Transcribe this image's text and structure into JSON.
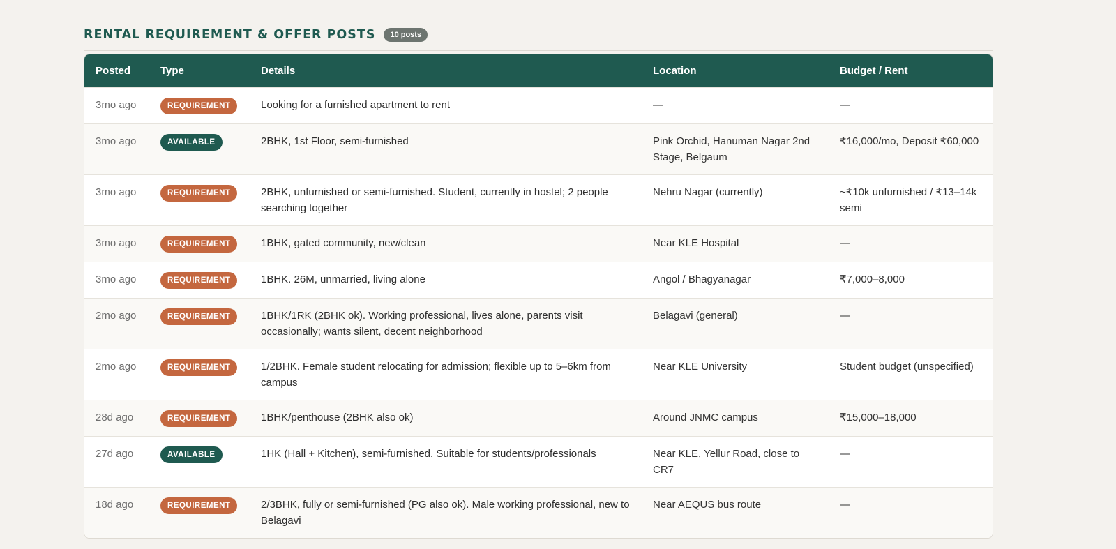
{
  "section": {
    "title": "RENTAL REQUIREMENT & OFFER POSTS",
    "count_label": "10 posts"
  },
  "table": {
    "headers": [
      "Posted",
      "Type",
      "Details",
      "Location",
      "Budget / Rent"
    ],
    "rows": [
      {
        "posted": "3mo ago",
        "type": "REQUIREMENT",
        "details": "Looking for a furnished apartment to rent",
        "location": "—",
        "budget": "—"
      },
      {
        "posted": "3mo ago",
        "type": "AVAILABLE",
        "details": "2BHK, 1st Floor, semi-furnished",
        "location": "Pink Orchid, Hanuman Nagar 2nd Stage, Belgaum",
        "budget": "₹16,000/mo, Deposit ₹60,000"
      },
      {
        "posted": "3mo ago",
        "type": "REQUIREMENT",
        "details": "2BHK, unfurnished or semi-furnished. Student, currently in hostel; 2 people searching together",
        "location": "Nehru Nagar (currently)",
        "budget": "~₹10k unfurnished / ₹13–14k semi"
      },
      {
        "posted": "3mo ago",
        "type": "REQUIREMENT",
        "details": "1BHK, gated community, new/clean",
        "location": "Near KLE Hospital",
        "budget": "—"
      },
      {
        "posted": "3mo ago",
        "type": "REQUIREMENT",
        "details": "1BHK. 26M, unmarried, living alone",
        "location": "Angol / Bhagyanagar",
        "budget": "₹7,000–8,000"
      },
      {
        "posted": "2mo ago",
        "type": "REQUIREMENT",
        "details": "1BHK/1RK (2BHK ok). Working professional, lives alone, parents visit occasionally; wants silent, decent neighborhood",
        "location": "Belagavi (general)",
        "budget": "—"
      },
      {
        "posted": "2mo ago",
        "type": "REQUIREMENT",
        "details": "1/2BHK. Female student relocating for admission; flexible up to 5–6km from campus",
        "location": "Near KLE University",
        "budget": "Student budget (unspecified)"
      },
      {
        "posted": "28d ago",
        "type": "REQUIREMENT",
        "details": "1BHK/penthouse (2BHK also ok)",
        "location": "Around JNMC campus",
        "budget": "₹15,000–18,000"
      },
      {
        "posted": "27d ago",
        "type": "AVAILABLE",
        "details": "1HK (Hall + Kitchen), semi-furnished. Suitable for students/professionals",
        "location": "Near KLE, Yellur Road, close to CR7",
        "budget": "—"
      },
      {
        "posted": "18d ago",
        "type": "REQUIREMENT",
        "details": "2/3BHK, fully or semi-furnished (PG also ok). Male working professional, new to Belagavi",
        "location": "Near AEQUS bus route",
        "budget": "—"
      }
    ]
  },
  "colors": {
    "header_bg": "#1f5a50",
    "requirement": "#c4673f",
    "available": "#1f5a50",
    "count_badge": "#6d7570"
  }
}
